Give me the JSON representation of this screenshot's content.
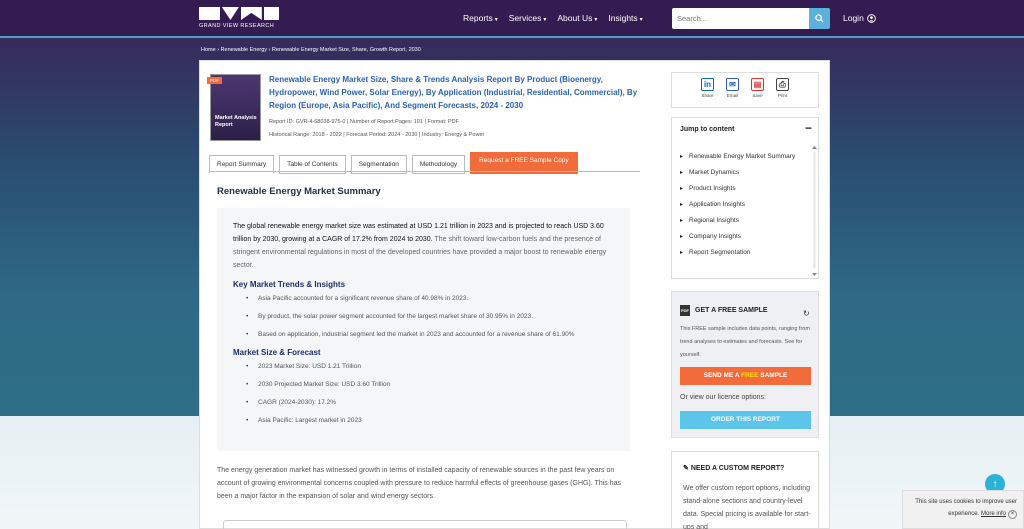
{
  "header": {
    "logo_text": "GRAND VIEW RESEARCH",
    "nav": [
      "Reports",
      "Services",
      "About Us",
      "Insights"
    ],
    "search_placeholder": "Search...",
    "login": "Login"
  },
  "breadcrumb": "Home  ›  Renewable Energy  ›  Renewable Energy Market Size, Share, Growth Report, 2030",
  "report": {
    "badge": "PDF",
    "cover_text": "Market Analysis Report",
    "title": "Renewable Energy Market Size, Share & Trends Analysis Report By Product (Bioenergy, Hydropower, Wind Power, Solar Energy), By Application (Industrial, Residential, Commercial), By Region (Europe, Asia Pacific), And Segment Forecasts, 2024 - 2030",
    "meta_line1": "Report ID: GVR-4-68038-975-0   |   Number of Report Pages: 101   |   Format: PDF",
    "meta_line2": "Historical Range: 2018 - 2022   |   Forecast Period: 2024 - 2030   |   Industry: Energy & Power"
  },
  "tabs": [
    "Report Summary",
    "Table of Contents",
    "Segmentation",
    "Methodology"
  ],
  "sample_tab": "Request a FREE Sample Copy",
  "summary": {
    "heading": "Renewable Energy Market Summary",
    "intro_bold": "The global renewable energy market size was estimated at USD 1.21 trillion in 2023 and is projected to reach USD 3.60 trillion by 2030, growing at a CAGR of 17.2% from 2024 to 2030.",
    "intro_rest": " The shift toward low-carbon fuels and the presence of stringent environmental regulations in most of the developed countries have provided a major boost to renewable energy sector.",
    "trends_heading": "Key Market Trends & Insights",
    "trends": [
      "Asia Pacific accounted for a significant revenue share of 40.98% in 2023.",
      "By product, the solar power segment accounted for the largest market share of 30.95% in 2023.",
      "Based on application, industrial segment led the market in 2023 and accounted for a revenue share of 61.90%"
    ],
    "forecast_heading": "Market Size & Forecast",
    "forecast": [
      "2023 Market Size: USD 1.21 Trillion",
      "2030 Projected Market Size: USD 3.60 Trillion",
      "CAGR (2024-2030): 17.2%",
      "Asia Pacific: Largest market in 2023"
    ]
  },
  "bottom_para": "The energy generation market has witnessed growth in terms of installed capacity of renewable sources in the past few years on account of growing environmental concerns coupled with pressure to reduce harmful effects of greenhouse gases (GHG). This has been a major factor in the expansion of solar and wind energy sectors.",
  "share": [
    {
      "icon": "linkedin-icon",
      "label": "Share",
      "glyph": "in",
      "color": "#0a66c2"
    },
    {
      "icon": "email-icon",
      "label": "Email",
      "glyph": "✉",
      "color": "#2b63b0"
    },
    {
      "icon": "pdf-icon",
      "label": "Save",
      "glyph": "⎙",
      "color": "#d33"
    },
    {
      "icon": "print-icon",
      "label": "Print",
      "glyph": "⎙",
      "color": "#444"
    }
  ],
  "toc": {
    "heading": "Jump to content",
    "items": [
      "Renewable Energy Market Summary",
      "Market Dynamics",
      "Product Insights",
      "Application Insights",
      "Regional Insights",
      "Company Insights",
      "Report Segmentation"
    ]
  },
  "sample_card": {
    "heading": "GET A FREE SAMPLE",
    "desc": "This FREE sample includes data points, ranging from trend analyses to estimates and forecasts. See for yourself.",
    "btn_pre": "SEND ME A ",
    "btn_hl": "FREE",
    "btn_post": " SAMPLE",
    "or_text": "Or view our licence options:",
    "order_btn": "ORDER THIS REPORT"
  },
  "custom_card": {
    "heading": "NEED A CUSTOM REPORT?",
    "desc": "We offer custom report options, including stand-alone sections and country-level data. Special pricing is available for start-ups and"
  },
  "cookie": {
    "text": "This site uses cookies to improve user experience.",
    "more": "More info"
  },
  "colors": {
    "brand": "#341b52",
    "accent_orange": "#f26b3a",
    "accent_blue": "#5bc5ea",
    "link": "#2b63b0"
  }
}
